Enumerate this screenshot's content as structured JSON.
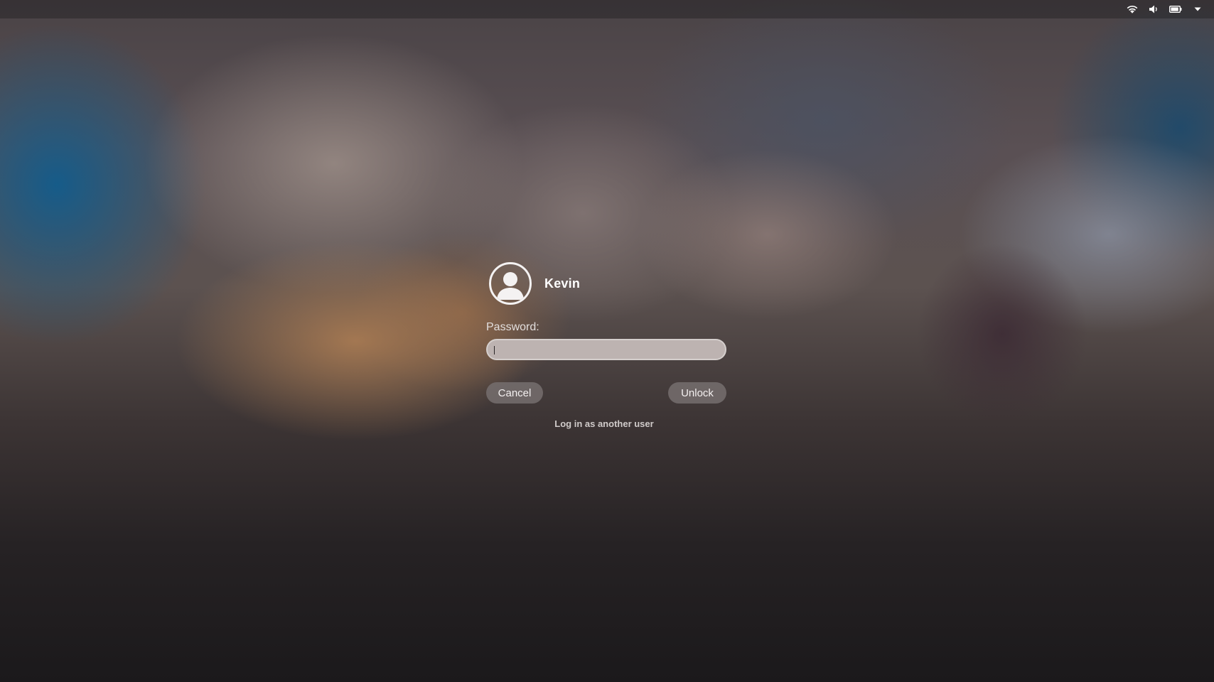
{
  "top_bar": {
    "indicators": [
      {
        "icon": "wifi-icon"
      },
      {
        "icon": "volume-icon"
      },
      {
        "icon": "battery-icon"
      },
      {
        "icon": "system-menu-arrow-icon"
      }
    ]
  },
  "lock_screen": {
    "avatar_icon": "user-avatar-icon",
    "username": "Kevin",
    "password_label": "Password:",
    "password_value": "",
    "cancel_label": "Cancel",
    "unlock_label": "Unlock",
    "switch_user_label": "Log in as another user"
  },
  "colors": {
    "text_primary": "#ffffff",
    "field_background": "#bdb3b1",
    "button_background": "#766e6e"
  }
}
